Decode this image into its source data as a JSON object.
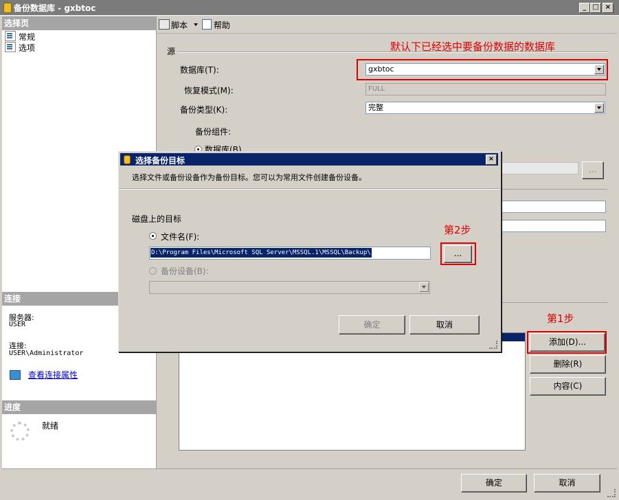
{
  "window": {
    "title": "备份数据库 - gxbtoc"
  },
  "left": {
    "select_page_header": "选择页",
    "pages": [
      {
        "label": "常规"
      },
      {
        "label": "选项"
      }
    ],
    "connection_header": "连接",
    "server_label": "服务器:",
    "server_value": "USER",
    "connection_label": "连接:",
    "connection_value": "USER\\Administrator",
    "view_props_link": "查看连接属性",
    "progress_header": "进度",
    "progress_status": "就绪"
  },
  "toolbar": {
    "script_label": "脚本",
    "help_label": "帮助"
  },
  "source": {
    "section_label": "源",
    "database_label": "数据库(T):",
    "database_value": "gxbtoc",
    "recovery_label": "恢复模式(M):",
    "recovery_value": "FULL",
    "backup_type_label": "备份类型(K):",
    "backup_type_value": "完整",
    "component_label": "备份组件:",
    "component_db_option": "数据库(B)"
  },
  "destination": {
    "add_button": "添加(D)...",
    "remove_button": "删除(R)",
    "contents_button": "内容(C)"
  },
  "footer": {
    "ok_button": "确定",
    "cancel_button": "取消"
  },
  "annotations": {
    "note_top": "默认下已经选中要备份数据的数据库",
    "step1": "第1步",
    "step2": "第2步"
  },
  "dialog": {
    "title": "选择备份目标",
    "description": "选择文件或备份设备作为备份目标。您可以为常用文件创建备份设备。",
    "section_label": "磁盘上的目标",
    "file_name_option": "文件名(F):",
    "file_path": "D:\\Program Files\\Microsoft SQL Server\\MSSQL.1\\MSSQL\\Backup\\",
    "browse_button": "...",
    "device_option": "备份设备(B):",
    "ok_button": "确定",
    "cancel_button": "取消"
  },
  "colors": {
    "annotation_red": "#e00000",
    "title_blue": "#0a246a",
    "link_blue": "#0000cc"
  }
}
